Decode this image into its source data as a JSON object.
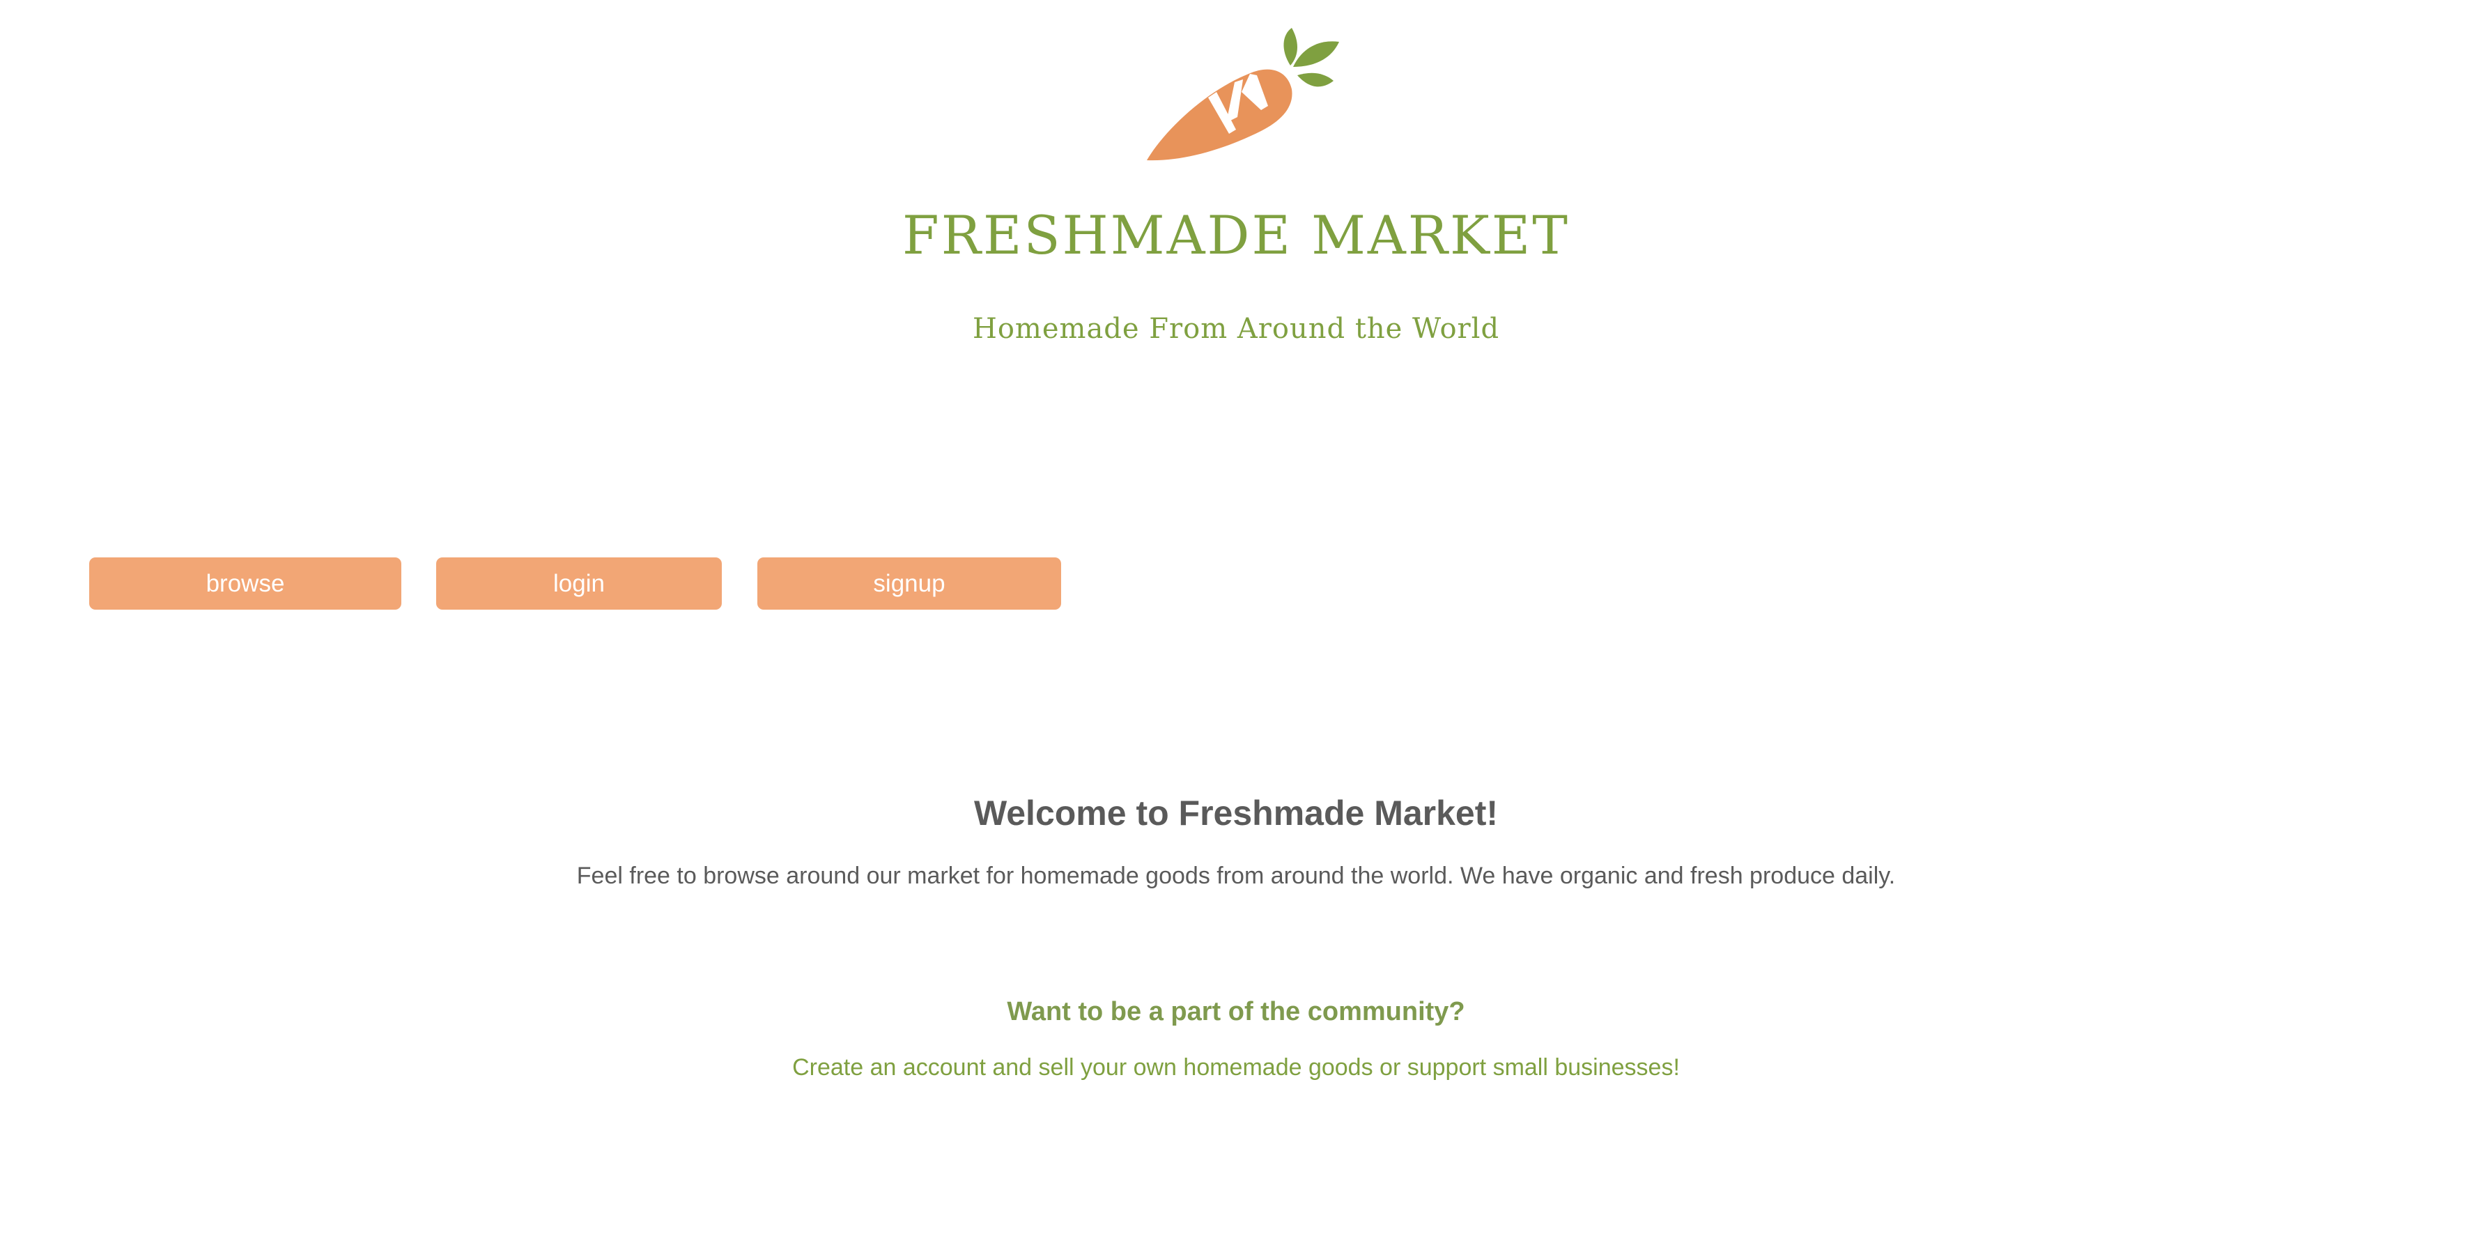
{
  "header": {
    "logo_icon": "carrot-icon",
    "title": "FRESHMADE MARKET",
    "subtitle": "Homemade From Around the World"
  },
  "nav": {
    "buttons": [
      {
        "label": "browse"
      },
      {
        "label": "login"
      },
      {
        "label": "signup"
      }
    ]
  },
  "welcome": {
    "heading": "Welcome to Freshmade Market!",
    "text": "Feel free to browse around our market for homemade goods from around the world. We have organic and fresh produce daily."
  },
  "community": {
    "heading": "Want to be a part of the community?",
    "text": "Create an account and sell your own homemade goods or support small businesses!"
  },
  "colors": {
    "brand_green": "#7fa040",
    "button_orange": "#f2a675",
    "carrot_orange": "#e8935a",
    "leaf_green": "#7fa040",
    "text_gray": "#5a5a5a"
  }
}
